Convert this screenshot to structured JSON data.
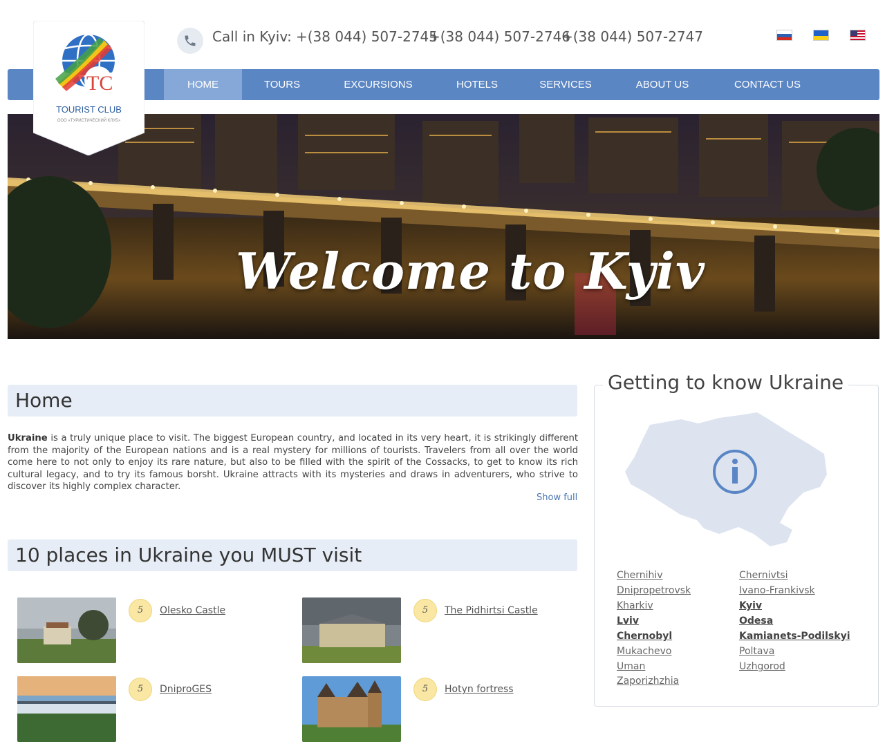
{
  "brand": {
    "name": "TOURIST CLUB",
    "tagline": "ООО «ТУРИСТИЧЕСКИЙ КЛУБ»",
    "monogram": "TC"
  },
  "contact": {
    "label": "Call in Kyiv:",
    "phones": [
      "+(38 044) 507-2745",
      "+(38 044) 507-2746",
      "+(38 044) 507-2747"
    ]
  },
  "languages": [
    "ru-flag-icon",
    "ua-flag-icon",
    "us-flag-icon"
  ],
  "nav": {
    "items": [
      "HOME",
      "TOURS",
      "EXCURSIONS",
      "HOTELS",
      "SERVICES",
      "ABOUT US",
      "CONTACT US"
    ],
    "active": "HOME"
  },
  "banner": {
    "text": "Welcome to Kyiv"
  },
  "home": {
    "title": "Home",
    "intro_bold": "Ukraine",
    "intro_text": " is a truly unique place to visit. The biggest European country, and located in its very heart, it is strikingly different from the majority of the European nations and is a real mystery for millions of tourists. Travelers from all over the world come here to not only to enjoy its rare nature, but also to be filled with the spirit of the Cossacks, to get to know its rich cultural legacy, and to try its famous borsht. Ukraine attracts with its mysteries and draws in adventurers, who strive to discover its highly complex character.",
    "show_full": "Show full"
  },
  "places": {
    "title": "10 places in Ukraine you MUST visit",
    "items": [
      {
        "name": "Olesko Castle",
        "rating": "5"
      },
      {
        "name": "The Pidhirtsi Castle",
        "rating": "5"
      },
      {
        "name": "DniproGES",
        "rating": "5"
      },
      {
        "name": "Hotyn fortress",
        "rating": "5"
      }
    ]
  },
  "sidebar": {
    "title": "Getting to know Ukraine",
    "map_icon": "info-icon",
    "cities_left": [
      "Chernihiv",
      "Dnipropetrovsk",
      "Kharkiv",
      "Lviv",
      "Chernobyl",
      "Mukachevo",
      "Uman",
      "Zaporizhzhia"
    ],
    "cities_right": [
      "Chernivtsi",
      "Ivano-Frankivsk",
      "Kyiv",
      "Odesa",
      "Kamianets-Podilskyi",
      "Poltava",
      "Uzhgorod"
    ]
  },
  "colors": {
    "nav": "#5b86c4",
    "nav_active": "#86a8d8",
    "section_bg": "#e6edf6",
    "link": "#4a77b4",
    "rating_bg": "#f9e7a3"
  }
}
